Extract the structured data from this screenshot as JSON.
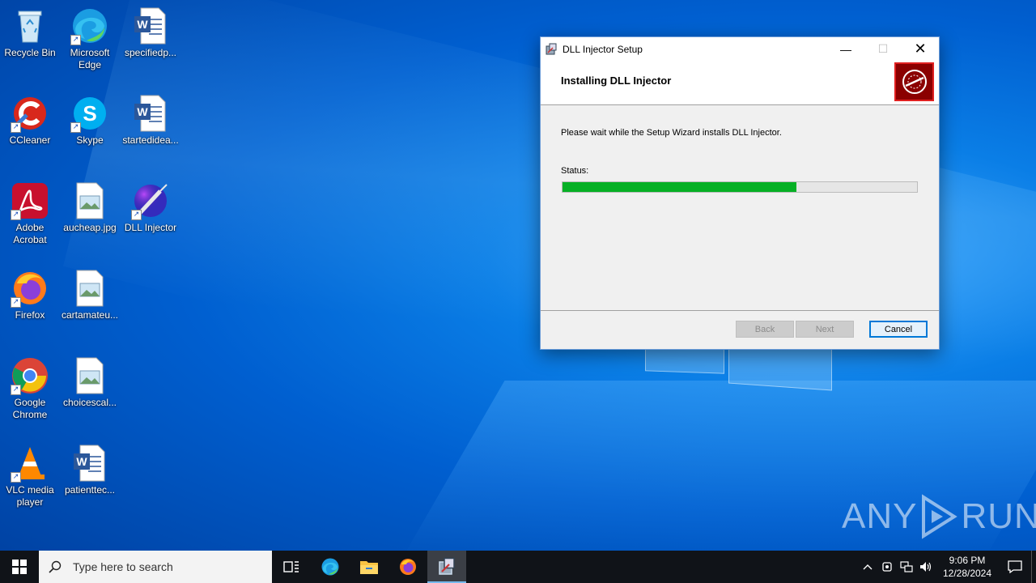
{
  "desktop": {
    "icons": [
      {
        "label": "Recycle Bin",
        "icon": "recycle-bin-icon"
      },
      {
        "label": "Microsoft Edge",
        "icon": "edge-icon"
      },
      {
        "label": "specifiedp...",
        "icon": "word-doc-icon"
      },
      {
        "label": "CCleaner",
        "icon": "ccleaner-icon"
      },
      {
        "label": "Skype",
        "icon": "skype-icon"
      },
      {
        "label": "startedidea...",
        "icon": "word-doc-icon"
      },
      {
        "label": "Adobe Acrobat",
        "icon": "acrobat-icon"
      },
      {
        "label": "aucheap.jpg",
        "icon": "image-file-icon"
      },
      {
        "label": "DLL Injector",
        "icon": "dll-injector-icon"
      },
      {
        "label": "Firefox",
        "icon": "firefox-icon"
      },
      {
        "label": "cartamateu...",
        "icon": "image-file-icon"
      },
      {
        "label": "Google Chrome",
        "icon": "chrome-icon"
      },
      {
        "label": "choicescal...",
        "icon": "image-file-icon"
      },
      {
        "label": "VLC media player",
        "icon": "vlc-icon"
      },
      {
        "label": "patienttec...",
        "icon": "word-doc-icon"
      }
    ]
  },
  "window": {
    "title": "DLL Injector Setup",
    "heading": "Installing DLL Injector",
    "message": "Please wait while the Setup Wizard installs DLL Injector.",
    "status_label": "Status:",
    "progress_fraction": 0.66,
    "buttons": {
      "back": "Back",
      "next": "Next",
      "cancel": "Cancel"
    },
    "controls": {
      "minimize": "—",
      "maximize": "☐",
      "close": "✕"
    }
  },
  "watermark": {
    "left": "ANY",
    "right": "RUN"
  },
  "taskbar": {
    "search_placeholder": "Type here to search",
    "apps": [
      "task-view-icon",
      "edge-icon",
      "file-explorer-icon",
      "firefox-icon",
      "setup-installer-icon"
    ],
    "clock": {
      "time": "9:06 PM",
      "date": "12/28/2024"
    }
  },
  "colors": {
    "progress": "#06b025",
    "accent": "#0078d7",
    "taskbar": "#101318"
  }
}
